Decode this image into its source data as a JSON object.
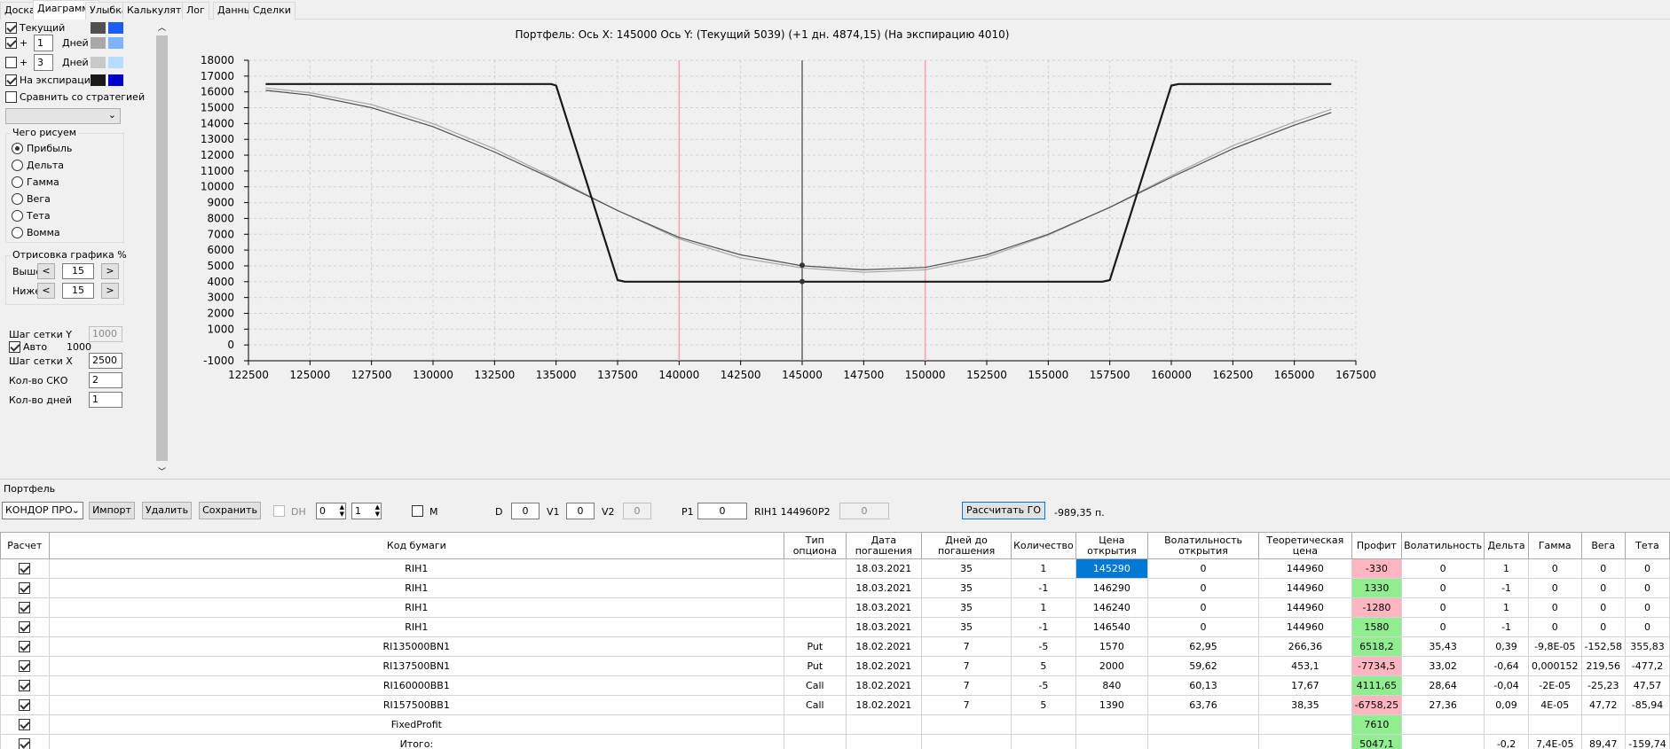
{
  "tabs": [
    "Доска",
    "Диаграмма",
    "Улыбка",
    "Калькулятор",
    "Лог",
    "Данные",
    "Сделки"
  ],
  "active_tab": "Диаграмма",
  "left_panel": {
    "current_label": "Текущий",
    "plus": "+",
    "days_label": "Дней",
    "row1_days": "1",
    "row2_days": "3",
    "expiration_label": "На экспирацию",
    "compare_label": "Сравнить со стратегией",
    "draw_group_title": "Чего рисуем",
    "draw_options": [
      "Прибыль",
      "Дельта",
      "Гамма",
      "Вега",
      "Тета",
      "Вомма"
    ],
    "render_group_title": "Отрисовка графика %",
    "above_label": "Выше",
    "below_label": "Ниже",
    "above_value": "15",
    "below_value": "15",
    "grid_y_label": "Шаг сетки Y",
    "grid_y_value": "1000",
    "auto_label": "Авто",
    "auto_value": "1000",
    "grid_x_label": "Шаг сетки X",
    "grid_x_value": "2500",
    "sko_label": "Кол-во СКО",
    "sko_value": "2",
    "days_count_label": "Кол-во дней",
    "days_count_value": "1",
    "colors": {
      "current": [
        "#505050",
        "#1e5bf0"
      ],
      "plus1": [
        "#a8a8a8",
        "#7eb3ff"
      ],
      "plus3": [
        "#c8c8c8",
        "#b6dcff"
      ],
      "expiration": [
        "#1a1a1a",
        "#0000c8"
      ]
    }
  },
  "chart_title": "Портфель: Ось X: 145000 Ось Y:  (Текущий 5039)  (+1 дн. 4874,15)  (На экспирацию 4010)",
  "chart_data": {
    "type": "line",
    "xlim": [
      122500,
      167500
    ],
    "ylim": [
      -1000,
      18000
    ],
    "x_ticks": [
      122500,
      125000,
      127500,
      130000,
      132500,
      135000,
      137500,
      140000,
      142500,
      145000,
      147500,
      150000,
      152500,
      155000,
      157500,
      160000,
      162500,
      165000,
      167500
    ],
    "y_ticks": [
      -1000,
      0,
      1000,
      2000,
      3000,
      4000,
      5000,
      6000,
      7000,
      8000,
      9000,
      10000,
      11000,
      12000,
      13000,
      14000,
      15000,
      16000,
      17000,
      18000
    ],
    "grid": true,
    "vertical_markers": {
      "current_x": 145000,
      "pink_lines": [
        140000,
        150000
      ]
    },
    "series": [
      {
        "color": "#1a1a1a",
        "x": [
          123200,
          134800,
          135000,
          137500,
          137800,
          157200,
          157500,
          160000,
          160300,
          166500
        ],
        "y": [
          16500,
          16500,
          16400,
          4100,
          4000,
          4000,
          4100,
          16400,
          16500,
          16500
        ]
      },
      {
        "color": "#505050",
        "x": [
          123200,
          125000,
          127500,
          130000,
          132500,
          135000,
          137500,
          140000,
          142500,
          145000,
          147500,
          150000,
          152500,
          155000,
          157500,
          160000,
          162500,
          165000,
          166500
        ],
        "y": [
          16100,
          15800,
          15000,
          13800,
          12200,
          10400,
          8500,
          6800,
          5700,
          5000,
          4750,
          4900,
          5700,
          7000,
          8700,
          10600,
          12400,
          13900,
          14700
        ]
      },
      {
        "color": "#a8a8a8",
        "x": [
          123200,
          125000,
          127500,
          130000,
          132500,
          135000,
          137500,
          140000,
          142500,
          145000,
          147500,
          150000,
          152500,
          155000,
          157500,
          160000,
          162500,
          165000,
          166500
        ],
        "y": [
          16250,
          15950,
          15200,
          14000,
          12400,
          10500,
          8500,
          6700,
          5500,
          4870,
          4600,
          4750,
          5550,
          6950,
          8700,
          10700,
          12600,
          14100,
          14900
        ]
      }
    ],
    "markers": [
      {
        "x": 145000,
        "y": 5039
      },
      {
        "x": 145000,
        "y": 4010
      }
    ]
  },
  "portfolio": {
    "label": "Портфель",
    "strategy": "КОНДОР ПРО",
    "import": "Импорт",
    "delete": "Удалить",
    "save": "Сохранить",
    "dh_label": "DH",
    "dh_val1": "0",
    "dh_val2": "1",
    "m_label": "M",
    "d_label": "D",
    "d_value": "0",
    "v1_label": "V1",
    "v1_value": "0",
    "v2_label": "V2",
    "v2_value": "0",
    "p1_label": "P1",
    "p1_value": "0",
    "rih_text": "RIH1 144960",
    "p2_label": "P2",
    "p2_value": "0",
    "calc_go": "Рассчитать ГО",
    "go_value": "-989,35 п."
  },
  "table": {
    "headers": [
      "Расчет",
      "Код бумаги",
      "Тип опциона",
      "Дата погашения",
      "Дней до погашения",
      "Количество",
      "Цена открытия",
      "Волатильность открытия",
      "Теоретическая цена",
      "Профит",
      "Волатильность",
      "Дельта",
      "Гамма",
      "Вега",
      "Тета"
    ],
    "rows": [
      {
        "checked": true,
        "cells": [
          "RIH1",
          "",
          "18.03.2021",
          "35",
          "1",
          "145290",
          "0",
          "144960",
          "-330",
          "0",
          "1",
          "0",
          "0",
          "0"
        ],
        "profit_sign": "neg",
        "price_selected": true
      },
      {
        "checked": true,
        "cells": [
          "RIH1",
          "",
          "18.03.2021",
          "35",
          "-1",
          "146290",
          "0",
          "144960",
          "1330",
          "0",
          "-1",
          "0",
          "0",
          "0"
        ],
        "profit_sign": "pos"
      },
      {
        "checked": true,
        "cells": [
          "RIH1",
          "",
          "18.03.2021",
          "35",
          "1",
          "146240",
          "0",
          "144960",
          "-1280",
          "0",
          "1",
          "0",
          "0",
          "0"
        ],
        "profit_sign": "neg"
      },
      {
        "checked": true,
        "cells": [
          "RIH1",
          "",
          "18.03.2021",
          "35",
          "-1",
          "146540",
          "0",
          "144960",
          "1580",
          "0",
          "-1",
          "0",
          "0",
          "0"
        ],
        "profit_sign": "pos"
      },
      {
        "checked": true,
        "cells": [
          "RI135000BN1",
          "Put",
          "18.02.2021",
          "7",
          "-5",
          "1570",
          "62,95",
          "266,36",
          "6518,2",
          "35,43",
          "0,39",
          "-9,8E-05",
          "-152,58",
          "355,83"
        ],
        "profit_sign": "pos"
      },
      {
        "checked": true,
        "cells": [
          "RI137500BN1",
          "Put",
          "18.02.2021",
          "7",
          "5",
          "2000",
          "59,62",
          "453,1",
          "-7734,5",
          "33,02",
          "-0,64",
          "0,000152",
          "219,56",
          "-477,2"
        ],
        "profit_sign": "neg"
      },
      {
        "checked": true,
        "cells": [
          "RI160000BB1",
          "Call",
          "18.02.2021",
          "7",
          "-5",
          "840",
          "60,13",
          "17,67",
          "4111,65",
          "28,64",
          "-0,04",
          "-2E-05",
          "-25,23",
          "47,57"
        ],
        "profit_sign": "pos"
      },
      {
        "checked": true,
        "cells": [
          "RI157500BB1",
          "Call",
          "18.02.2021",
          "7",
          "5",
          "1390",
          "63,76",
          "38,35",
          "-6758,25",
          "27,36",
          "0,09",
          "4E-05",
          "47,72",
          "-85,94"
        ],
        "profit_sign": "neg"
      },
      {
        "checked": true,
        "cells": [
          "FixedProfit",
          "",
          "",
          "",
          "",
          "",
          "",
          "",
          "7610",
          "",
          "",
          "",
          "",
          ""
        ],
        "profit_sign": "pos"
      },
      {
        "checked": true,
        "cells": [
          "Итого:",
          "",
          "",
          "",
          "",
          "",
          "",
          "",
          "5047,1",
          "",
          "-0,2",
          "7,4E-05",
          "89,47",
          "-159,74"
        ],
        "profit_sign": "pos"
      }
    ]
  }
}
